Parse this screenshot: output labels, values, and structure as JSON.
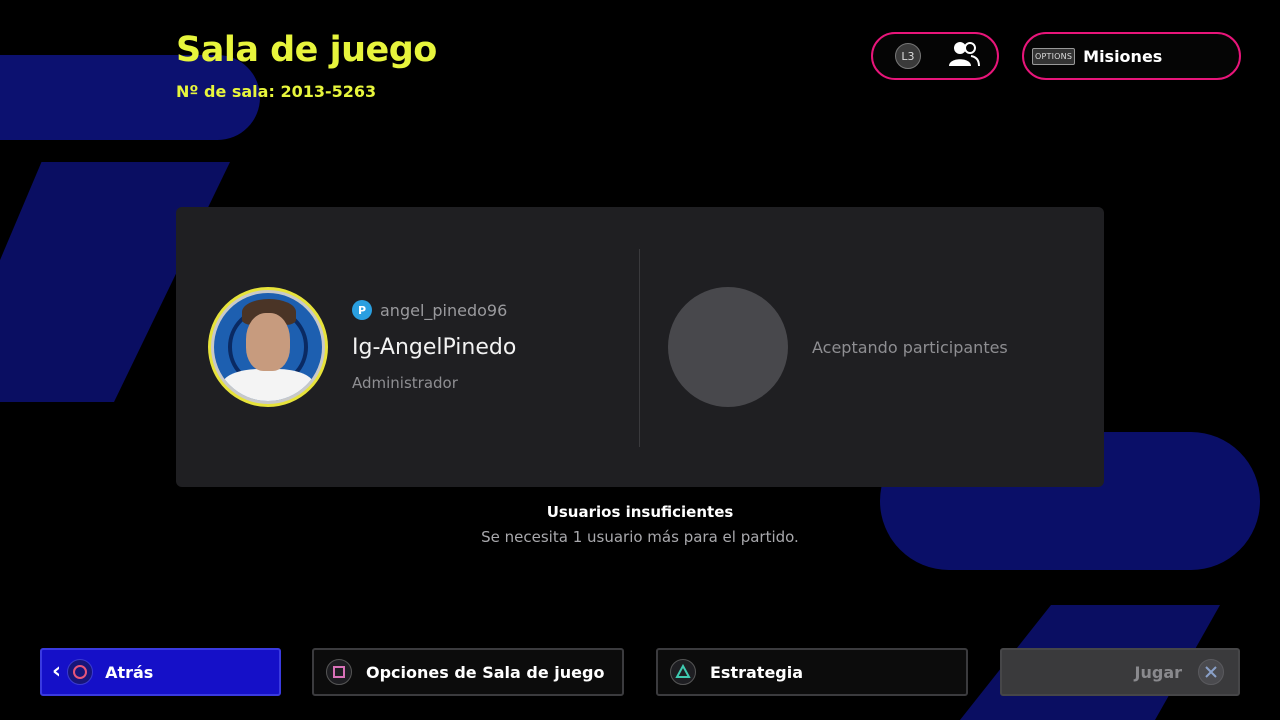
{
  "header": {
    "title": "Sala de juego",
    "room_label": "Nº de sala:",
    "room_number": "2013-5263"
  },
  "top_buttons": {
    "friends_key": "L3",
    "missions_key": "OPTIONS",
    "missions_label": "Misiones"
  },
  "host": {
    "psn_id": "angel_pinedo96",
    "name": "Ig-AngelPinedo",
    "role": "Administrador"
  },
  "guest_slot": {
    "status": "Aceptando participantes"
  },
  "notice": {
    "title": "Usuarios insuficientes",
    "message": "Se necesita 1 usuario más para el partido."
  },
  "footer": {
    "back_label": "Atrás",
    "options_label": "Opciones de Sala de juego",
    "strategy_label": "Estrategia",
    "play_label": "Jugar"
  },
  "colors": {
    "accent_yellow": "#e7f53c",
    "pill_border": "#e8157a",
    "back_button": "#1510c8",
    "panel_bg": "#1f1f22"
  }
}
